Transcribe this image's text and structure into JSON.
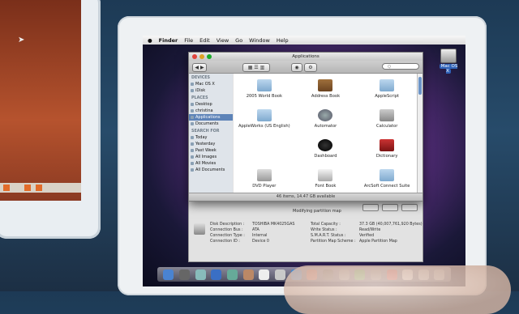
{
  "menubar": {
    "apple": "",
    "app": "Finder",
    "items": [
      "File",
      "Edit",
      "View",
      "Go",
      "Window",
      "Help"
    ]
  },
  "desktop": {
    "volume_label": "Mac OS X"
  },
  "finder": {
    "volume_title": "TOSHIBA MK4025GAS",
    "window_title": "Applications",
    "search_placeholder": "Q",
    "sidebar": {
      "devices_header": "DEVICES",
      "devices": [
        "Mac OS X",
        "iDisk"
      ],
      "places_header": "PLACES",
      "places": [
        "Desktop",
        "christina",
        "Applications",
        "Documents"
      ],
      "search_header": "SEARCH FOR",
      "searches": [
        "Today",
        "Yesterday",
        "Past Week",
        "All Images",
        "All Movies",
        "All Documents"
      ]
    },
    "items": [
      {
        "label": "2005 World Book",
        "icon": "folder-icon"
      },
      {
        "label": "Address Book",
        "icon": "book-icon"
      },
      {
        "label": "AppleScript",
        "icon": "folder-icon"
      },
      {
        "label": "AppleWorks (US English)",
        "icon": "folder-icon"
      },
      {
        "label": "Automator",
        "icon": "automator-icon"
      },
      {
        "label": "Calculator",
        "icon": "calculator-icon"
      },
      {
        "label": "",
        "icon": ""
      },
      {
        "label": "Dashboard",
        "icon": "dashboard-icon"
      },
      {
        "label": "Dictionary",
        "icon": "dictionary-icon"
      },
      {
        "label": "DVD Player",
        "icon": "dvd-player-icon"
      },
      {
        "label": "Font Book",
        "icon": "font-book-icon"
      },
      {
        "label": "ArcSoft Connect Suite",
        "icon": "folder-icon"
      }
    ],
    "status": "46 items, 14.47 GB available"
  },
  "disk_utility": {
    "repair_label": "Modifying partition map",
    "left_labels": [
      "Disk Description :",
      "Connection Bus :",
      "Connection Type :",
      "Connection ID :"
    ],
    "left_values": [
      "TOSHIBA MK4025GAS",
      "ATA",
      "Internal",
      "Device 0"
    ],
    "right_labels": [
      "Total Capacity :",
      "Write Status :",
      "S.M.A.R.T. Status :",
      "Partition Map Scheme :"
    ],
    "right_values": [
      "37.3 GB (40,007,761,920 Bytes)",
      "Read/Write",
      "Verified",
      "Apple Partition Map"
    ]
  },
  "colors": {
    "selection": "#5d83b8",
    "sidebar": "#dfe4ea"
  }
}
